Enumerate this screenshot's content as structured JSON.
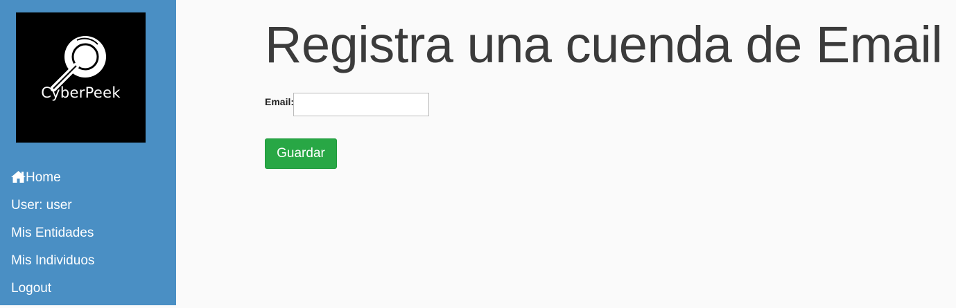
{
  "brand": {
    "name": "CyberPeek",
    "logo_icon": "magnifier-icon"
  },
  "sidebar": {
    "items": [
      {
        "label": "Home",
        "icon": "home-icon"
      },
      {
        "label": "User: user"
      },
      {
        "label": "Mis Entidades"
      },
      {
        "label": "Mis Individuos"
      },
      {
        "label": "Logout"
      }
    ]
  },
  "main": {
    "title": "Registra una cuenda de Email",
    "form": {
      "email_label": "Email:",
      "email_value": "",
      "email_placeholder": "",
      "save_label": "Guardar"
    }
  },
  "colors": {
    "sidebar": "#4a8fc4",
    "button": "#28a745",
    "background": "#fafafa"
  }
}
